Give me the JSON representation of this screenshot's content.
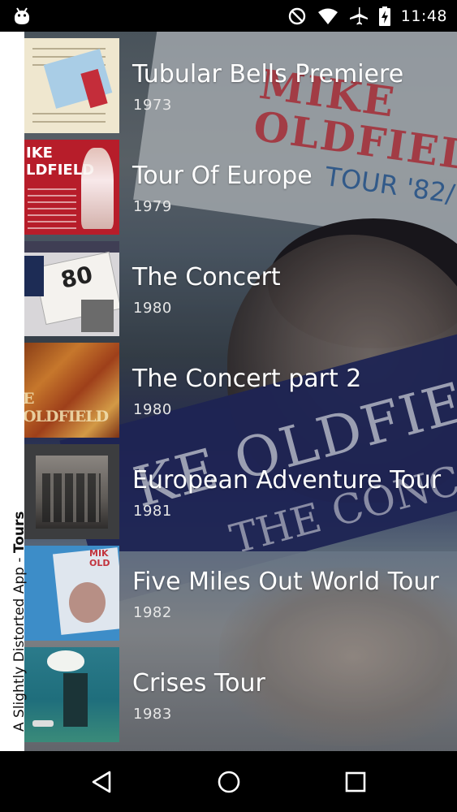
{
  "status_bar": {
    "time": "11:48",
    "icons": [
      "android-debug-icon",
      "do-not-disturb-icon",
      "wifi-icon",
      "airplane-mode-icon",
      "battery-charging-icon"
    ]
  },
  "side_label": {
    "prefix": "A Slightly Distorted App - ",
    "section": "Tours"
  },
  "tours": [
    {
      "title": "Tubular Bells Premiere",
      "year": "1973"
    },
    {
      "title": "Tour Of Europe",
      "year": "1979"
    },
    {
      "title": "The Concert",
      "year": "1980"
    },
    {
      "title": "The Concert part 2",
      "year": "1980"
    },
    {
      "title": "European Adventure Tour",
      "year": "1981"
    },
    {
      "title": "Five Miles Out World Tour",
      "year": "1982"
    },
    {
      "title": "Crises Tour",
      "year": "1983"
    }
  ],
  "background_text": {
    "mike": "MIKE",
    "oldfield": "OLDFIELD",
    "tour82": "TOUR '82/",
    "band_name": "KE OLDFIE",
    "band_sub": "THE CONC"
  },
  "thumbnails": {
    "t2_text": "IKE\nLDFIELD",
    "t3_number": "80",
    "t4_text": "E OLDFIELD",
    "t6_text": "MIK\nOLD"
  },
  "nav_bar": {
    "buttons": [
      "back-icon",
      "home-icon",
      "recent-apps-icon"
    ]
  }
}
